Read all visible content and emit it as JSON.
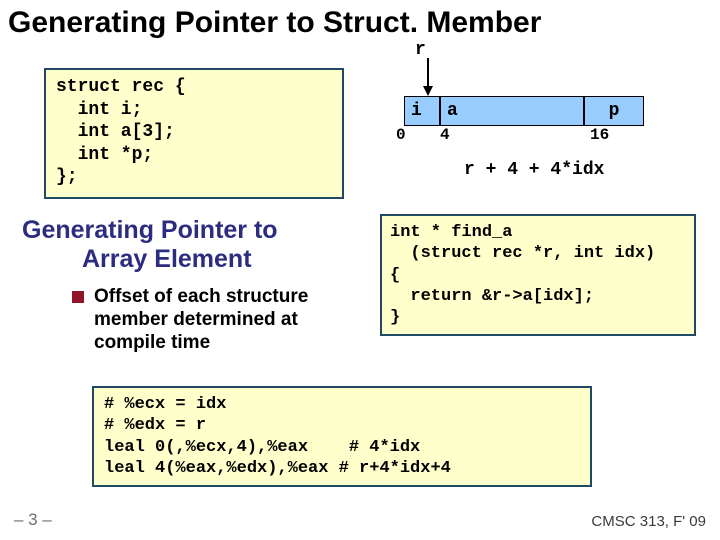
{
  "title": "Generating Pointer to Struct. Member",
  "r_label": "r",
  "struct_code": "struct rec {\n  int i;\n  int a[3];\n  int *p;\n};",
  "layout": {
    "i": "i",
    "a": "a",
    "p": "p",
    "off0": "0",
    "off4": "4",
    "off16": "16"
  },
  "formula": "r + 4 + 4*idx",
  "subtitle_l1": "Generating Pointer to",
  "subtitle_l2": "Array Element",
  "bullet_text": "Offset of each structure member determined at compile time",
  "find_code": "int * find_a\n  (struct rec *r, int idx)\n{\n  return &r->a[idx];\n}",
  "asm_code": "# %ecx = idx\n# %edx = r\nleal 0(,%ecx,4),%eax    # 4*idx\nleal 4(%eax,%edx),%eax # r+4*idx+4",
  "pagenum": "– 3 –",
  "course": "CMSC 313, F' 09"
}
